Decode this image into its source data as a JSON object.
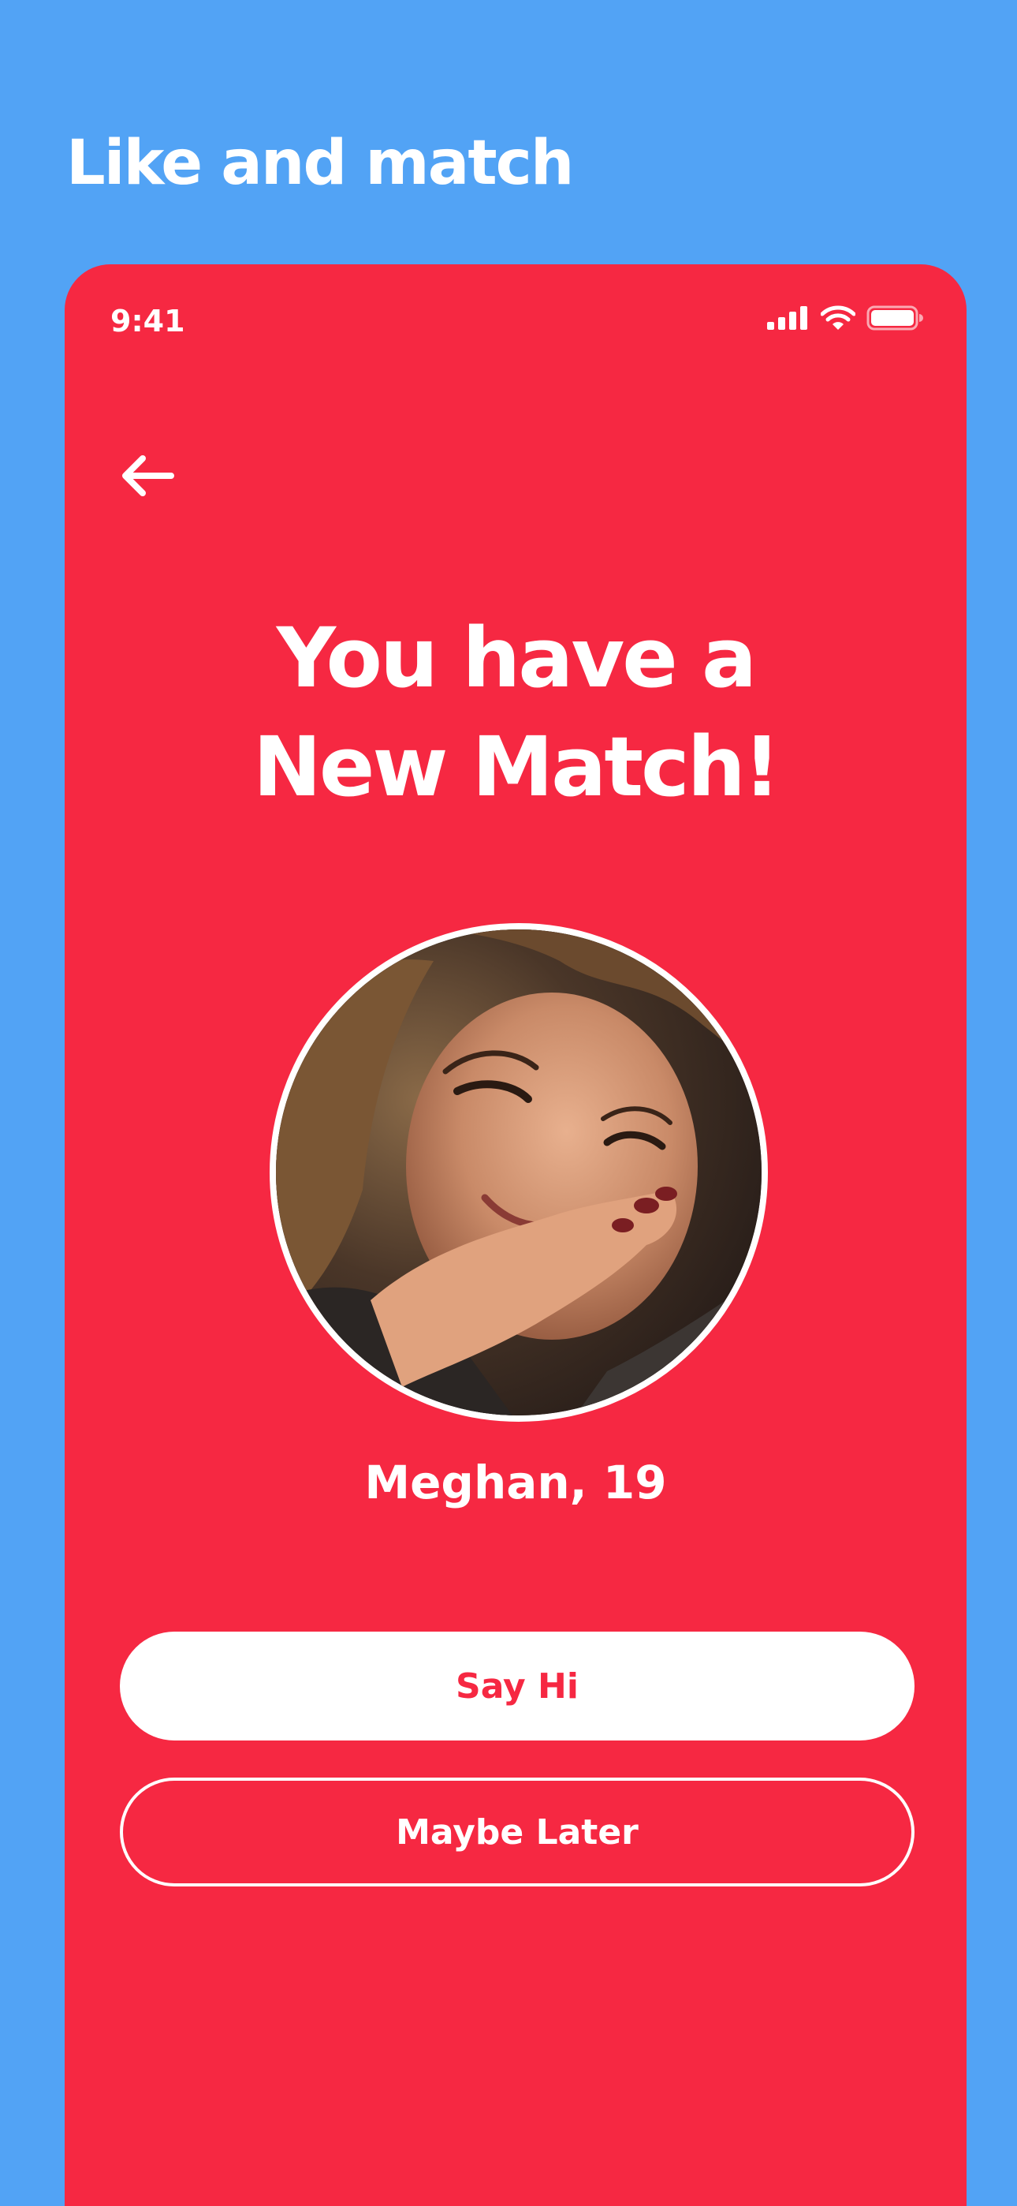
{
  "page": {
    "heading": "Like and match"
  },
  "status_bar": {
    "time": "9:41",
    "icons": [
      "cellular-signal-icon",
      "wifi-icon",
      "battery-icon"
    ]
  },
  "screen": {
    "back_icon": "arrow-left-icon",
    "title_line1": "You have a",
    "title_line2": "New Match!",
    "match_name": "Meghan, 19",
    "primary_button_label": "Say Hi",
    "secondary_button_label": "Maybe Later"
  },
  "colors": {
    "background": "#52A3F5",
    "accent": "#F62842",
    "text": "#FFFFFF"
  }
}
